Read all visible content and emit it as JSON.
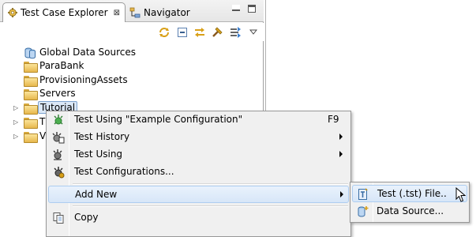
{
  "tabs": {
    "test_case_explorer": "Test Case Explorer",
    "navigator": "Navigator",
    "close_glyph": "⊠"
  },
  "toolbar_icons": [
    "sync-icon",
    "collapse-all-icon",
    "link-editor-icon",
    "hammer-icon",
    "filter-icon",
    "view-menu-icon"
  ],
  "tree": {
    "nodes": [
      {
        "label": "Global Data Sources"
      },
      {
        "label": "ParaBank"
      },
      {
        "label": "ProvisioningAssets"
      },
      {
        "label": "Servers"
      },
      {
        "label": "Tutorial",
        "selected": true
      },
      {
        "label": "T"
      },
      {
        "label": "V"
      }
    ]
  },
  "context_menu": {
    "items": [
      {
        "label": "Test Using \"Example Configuration\"",
        "shortcut": "F9"
      },
      {
        "label": "Test History"
      },
      {
        "label": "Test Using"
      },
      {
        "label": "Test Configurations..."
      },
      {
        "label": "Add New"
      },
      {
        "label": "Copy"
      }
    ]
  },
  "submenu": {
    "items": [
      {
        "label": "Test (.tst) File.."
      },
      {
        "label": "Data Source..."
      }
    ]
  },
  "colors": {
    "menu_background": "#f0f0f0",
    "highlight_border": "#aecdf0",
    "highlight_fill": "#dbe8f7",
    "folder_yellow": "#e7b84c"
  }
}
